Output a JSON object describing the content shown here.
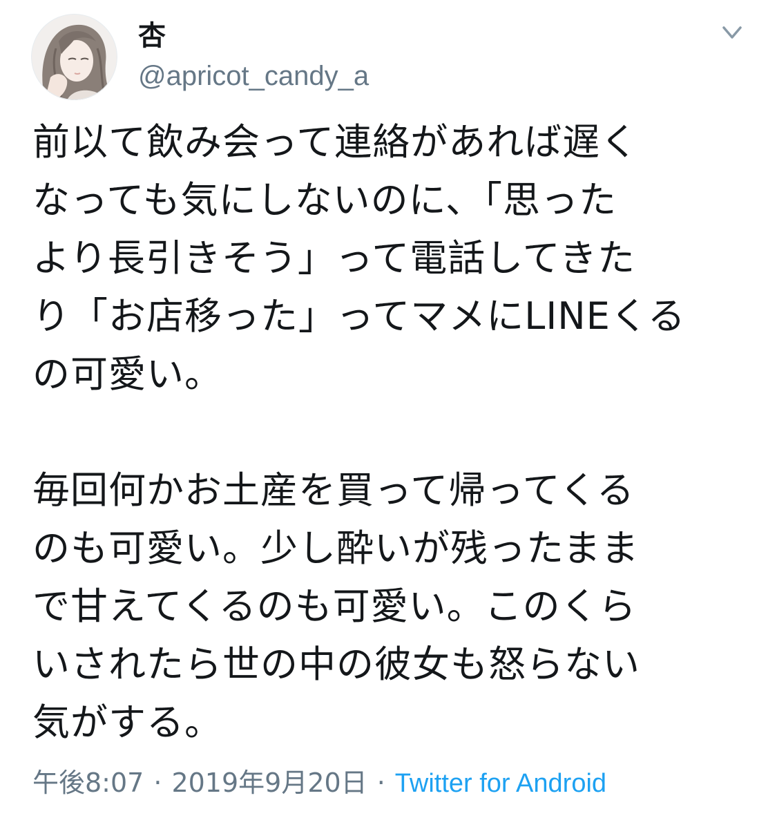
{
  "tweet": {
    "author": {
      "display_name": "杏",
      "handle": "@apricot_candy_a",
      "avatar_icon": "avatar-illustration-girl"
    },
    "menu_icon": "chevron-down-icon",
    "body": {
      "paragraphs": [
        {
          "lines": [
            "前以て飲み会って連絡があれば遅く",
            "なっても気にしないのに、「思った",
            "より長引きそう」って電話してきた",
            "り「お店移った」ってマメにLINEくる",
            "の可愛い。"
          ]
        },
        {
          "lines": [
            "毎回何かお土産を買って帰ってくる",
            "のも可愛い。少し酔いが残ったまま",
            "で甘えてくるのも可愛い。このくら",
            "いされたら世の中の彼女も怒らない",
            "気がする。"
          ]
        }
      ]
    },
    "meta": {
      "time": "午後8:07",
      "separator": "·",
      "date": "2019年9月20日",
      "source": "Twitter for Android"
    },
    "colors": {
      "text": "#14171a",
      "secondary": "#657786",
      "link": "#1da1f2",
      "background": "#ffffff"
    }
  }
}
